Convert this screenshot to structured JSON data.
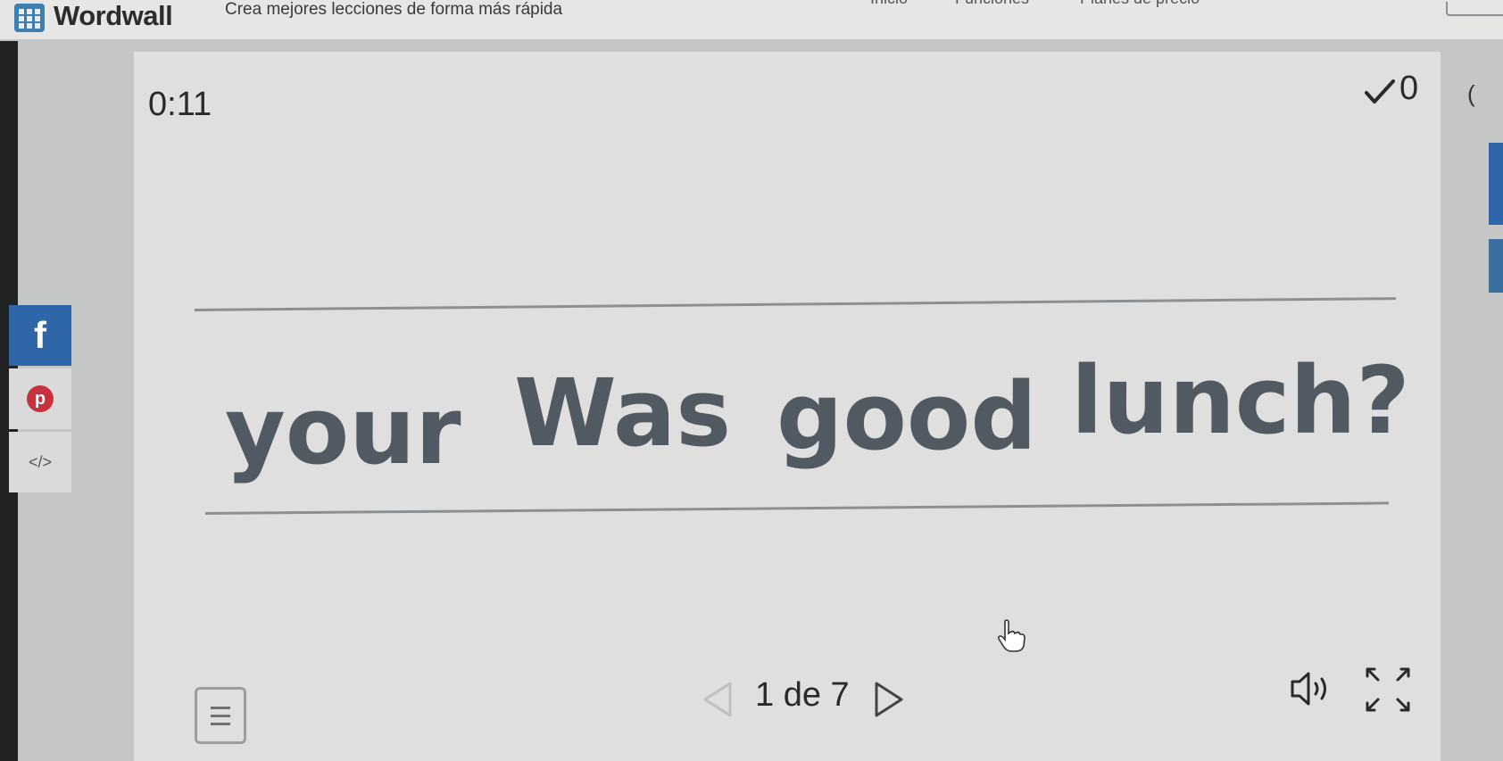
{
  "topbar": {
    "brand": "Wordwall",
    "tagline": "Crea mejores lecciones de forma más rápida",
    "nav": [
      "Inicio",
      "Funciones",
      "Planes de precio"
    ]
  },
  "game": {
    "timer": "0:11",
    "score": "0",
    "right_edge_text": "(",
    "words": [
      "your",
      "Was",
      "good",
      "lunch?"
    ],
    "pager": "1 de 7"
  },
  "share": {
    "facebook_glyph": "f",
    "pinterest_glyph": "p",
    "embed_glyph": "</>"
  },
  "colors": {
    "accent_blue": "#2f66a8",
    "word_color": "#515a62",
    "panel_bg": "#dedfde"
  }
}
